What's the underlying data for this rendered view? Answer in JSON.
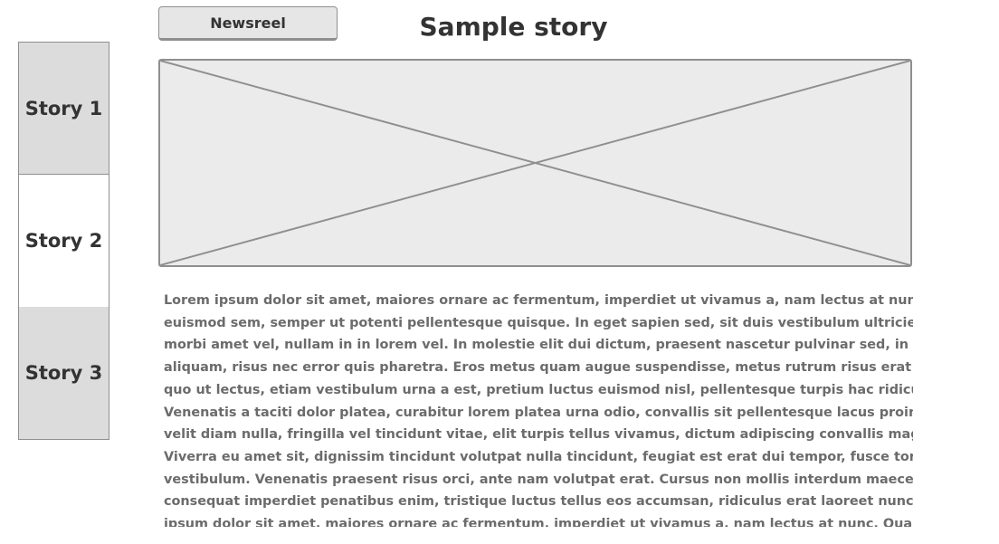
{
  "tabs": [
    {
      "label": "Story 1",
      "state": "shaded"
    },
    {
      "label": "Story 2",
      "state": "active"
    },
    {
      "label": "Story 3",
      "state": "shaded"
    }
  ],
  "header": {
    "newsreel_label": "Newsreel",
    "title": "Sample story"
  },
  "story": {
    "lines": [
      "Lorem ipsum dolor sit amet, maiores ornare ac fermentum, imperdiet ut vivamus a, nam lectus at nunc. Quam",
      "euismod sem, semper ut potenti pellentesque quisque. In eget sapien sed, sit duis vestibulum ultricies, placerat",
      "morbi amet vel, nullam in in lorem vel. In molestie elit dui dictum, praesent nascetur pulvinar sed, in dolor pede in",
      "aliquam, risus nec error quis pharetra. Eros metus quam augue suspendisse, metus rutrum risus erat in.  In ultrices",
      "quo ut lectus, etiam vestibulum urna a est, pretium luctus euismod nisl, pellentesque turpis hac ridiculus massa.",
      "Venenatis a taciti dolor platea, curabitur lorem platea urna odio, convallis sit pellentesque lacus proin. Et ipsum",
      "velit diam nulla, fringilla vel tincidunt vitae, elit turpis tellus vivamus, dictum adipiscing convallis magna id.",
      "Viverra eu amet sit, dignissim tincidunt volutpat nulla tincidunt, feugiat est erat dui tempor, fusce tortor auctor",
      "vestibulum. Venenatis praesent risus orci, ante nam volutpat erat. Cursus non mollis interdum maecenas,",
      "consequat imperdiet penatibus enim, tristique luctus tellus eos accumsan, ridiculus erat laoreet nunc.Lorem",
      "ipsum dolor sit amet, maiores ornare ac fermentum, imperdiet ut vivamus a, nam lectus at nunc. Quam euismod"
    ]
  },
  "colors": {
    "tab_shaded": "#dcdcdc",
    "border": "#8f8f8f",
    "placeholder_fill": "#ebebeb",
    "body_text": "#6b6b6b",
    "heading_text": "#333333"
  },
  "icons": {
    "image_placeholder": "image-placeholder-icon"
  }
}
